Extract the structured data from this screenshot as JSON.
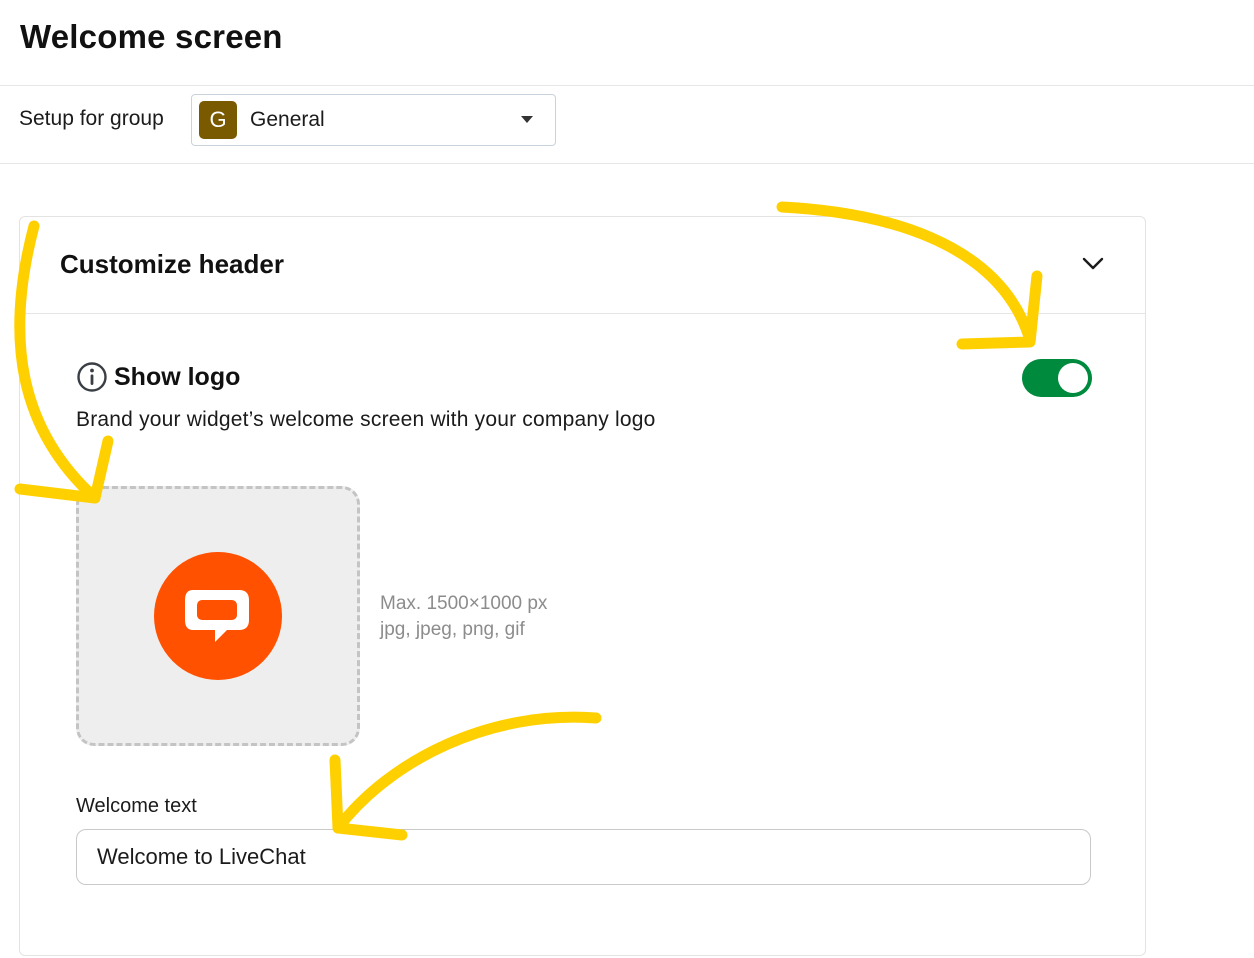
{
  "page": {
    "title": "Welcome screen"
  },
  "group_setup": {
    "label": "Setup for group",
    "avatar_letter": "G",
    "avatar_color": "#7a5a00",
    "selected_group": "General"
  },
  "card": {
    "title": "Customize header",
    "show_logo": {
      "title": "Show logo",
      "description": "Brand your widget’s welcome screen with your company logo",
      "enabled": true,
      "toggle_color": "#008a3e"
    },
    "logo_upload": {
      "logo_icon": "livechat-logo",
      "logo_color": "#ff5100",
      "hint_size": "Max. 1500×1000 px",
      "hint_formats": "jpg, jpeg, png, gif"
    },
    "welcome_text": {
      "label": "Welcome text",
      "value": "Welcome to LiveChat"
    }
  },
  "annotations": {
    "arrow_color": "#ffd000"
  }
}
